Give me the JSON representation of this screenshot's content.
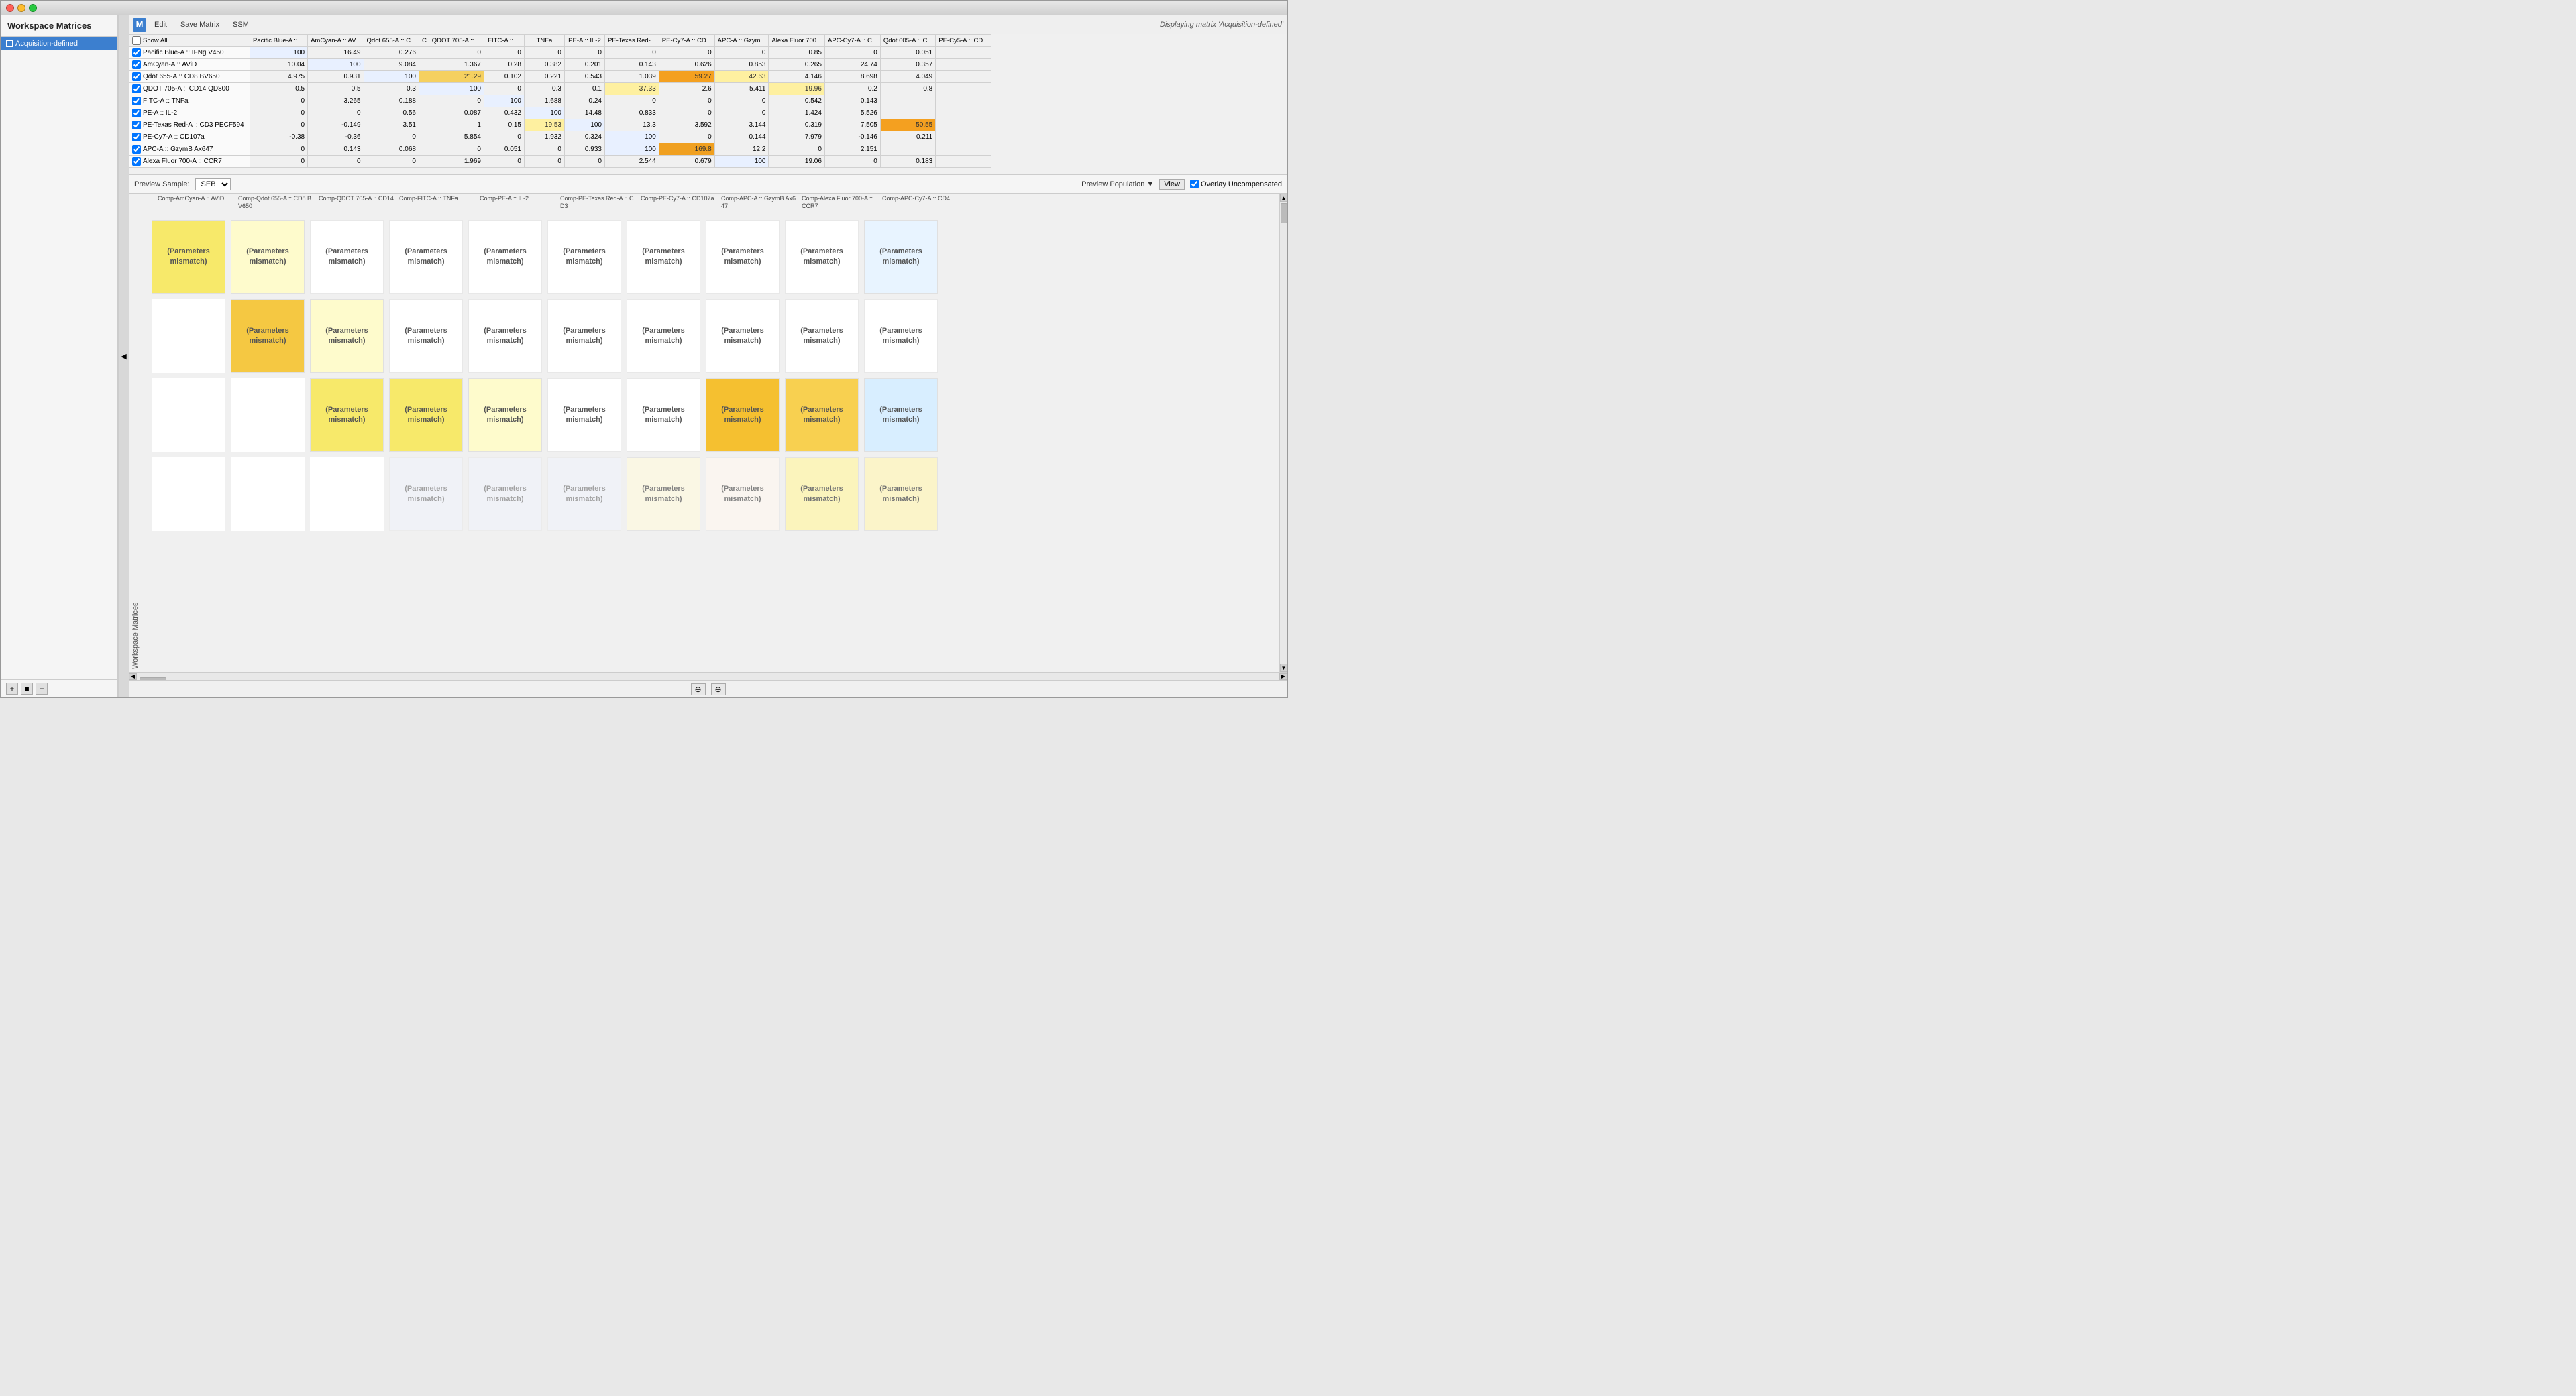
{
  "window": {
    "title": "Workspace Matrices",
    "display_info": "Displaying matrix 'Acquisition-defined'"
  },
  "toolbar": {
    "logo": "M",
    "menu": [
      "Edit",
      "Save Matrix",
      "SSM"
    ]
  },
  "sidebar": {
    "title": "Workspace Matrices",
    "items": [
      {
        "label": "Acquisition-defined",
        "selected": true
      }
    ],
    "add_label": "+",
    "square_label": "■",
    "minus_label": "−"
  },
  "matrix": {
    "show_all": "Show All",
    "columns": [
      "Pacific Blue-A :: ...",
      "AmCyan-A :: AV...",
      "Qdot 655-A :: C...",
      "C...QDOT 705-A :: ...",
      "FITC-A :: ...",
      "TNFa",
      "PE-A :: IL-2",
      "PE-Texas Red-...",
      "PE-Cy7-A :: CD...",
      "APC-A :: Gzym...",
      "Alexa Fluor 700...",
      "APC-Cy7-A :: C...",
      "Qdot 605-A :: C...",
      "PE-Cy5-A :: CD..."
    ],
    "rows": [
      {
        "label": "Pacific Blue-A :: IFNg V450",
        "values": [
          "100",
          "16.49",
          "0.276",
          "0",
          "0",
          "0",
          "0",
          "0",
          "0",
          "0",
          "0.85",
          "0",
          "0.051"
        ],
        "checked": true
      },
      {
        "label": "AmCyan-A :: AViD",
        "values": [
          "10.04",
          "100",
          "9.084",
          "1.367",
          "0.28",
          "0.382",
          "0.201",
          "0.143",
          "0.626",
          "0.853",
          "0.265",
          "24.74",
          "0.357"
        ],
        "checked": true
      },
      {
        "label": "Qdot 655-A :: CD8 BV650",
        "values": [
          "4.975",
          "0.931",
          "100",
          "21.29",
          "0.102",
          "0.221",
          "0.543",
          "1.039",
          "59.27",
          "42.63",
          "4.146",
          "8.698",
          "4.049"
        ],
        "checked": true
      },
      {
        "label": "QDOT 705-A :: CD14 QD800",
        "values": [
          "0.5",
          "0.5",
          "0.3",
          "100",
          "0",
          "0.3",
          "0.1",
          "37.33",
          "2.6",
          "5.411",
          "19.96",
          "0.2",
          "0.8"
        ],
        "checked": true
      },
      {
        "label": "FITC-A :: TNFa",
        "values": [
          "0",
          "3.265",
          "0.188",
          "0",
          "100",
          "1.688",
          "0.24",
          "0",
          "0",
          "0",
          "0.542",
          "0.143"
        ],
        "checked": true
      },
      {
        "label": "PE-A :: IL-2",
        "values": [
          "0",
          "0",
          "0.56",
          "0.087",
          "0.432",
          "100",
          "14.48",
          "0.833",
          "0",
          "0",
          "1.424",
          "5.526"
        ],
        "checked": true
      },
      {
        "label": "PE-Texas Red-A :: CD3 PECF594",
        "values": [
          "0",
          "-0.149",
          "3.51",
          "1",
          "0.15",
          "19.53",
          "100",
          "13.3",
          "3.592",
          "3.144",
          "0.319",
          "7.505",
          "50.55"
        ],
        "checked": true
      },
      {
        "label": "PE-Cy7-A :: CD107a",
        "values": [
          "-0.38",
          "-0.36",
          "0",
          "5.854",
          "0",
          "1.932",
          "0.324",
          "100",
          "0",
          "0.144",
          "7.979",
          "-0.146",
          "0.211"
        ],
        "checked": true
      },
      {
        "label": "APC-A :: GzymB Ax647",
        "values": [
          "0",
          "0.143",
          "0.068",
          "0",
          "0.051",
          "0",
          "0.933",
          "100",
          "169.8",
          "12.2",
          "0",
          "2.151"
        ],
        "checked": true
      },
      {
        "label": "Alexa Fluor 700-A :: CCR7",
        "values": [
          "0",
          "0",
          "0",
          "1.969",
          "0",
          "0",
          "0",
          "2.544",
          "0.679",
          "100",
          "19.06",
          "0",
          "0.183"
        ],
        "checked": true
      }
    ]
  },
  "preview": {
    "sample_label": "Preview Sample:",
    "sample_value": "SEB",
    "population_label": "Preview Population",
    "view_label": "View",
    "overlay_label": "Overlay Uncompensated",
    "overlay_checked": true
  },
  "comp_columns": [
    "Comp-AmCyan-A :: AViD",
    "Comp-Qdot 655-A :: CD8 BV650",
    "Comp-QDOT 705-A :: CD14",
    "Comp-FITC-A :: TNFa",
    "Comp-PE-A :: IL-2",
    "Comp-PE-Texas Red-A :: CD3",
    "Comp-PE-Cy7-A :: CD107a",
    "Comp-APC-A :: GzymB Ax647",
    "Comp-Alexa Fluor 700-A :: CCR7",
    "Comp-APC-Cy7-A :: CD4"
  ],
  "comp_grid_label": "Workspace Matrices",
  "mismatch_text": "(Parameters mismatch)",
  "bottom_buttons": {
    "zoom_out": "⊖",
    "zoom_in": "⊕"
  }
}
